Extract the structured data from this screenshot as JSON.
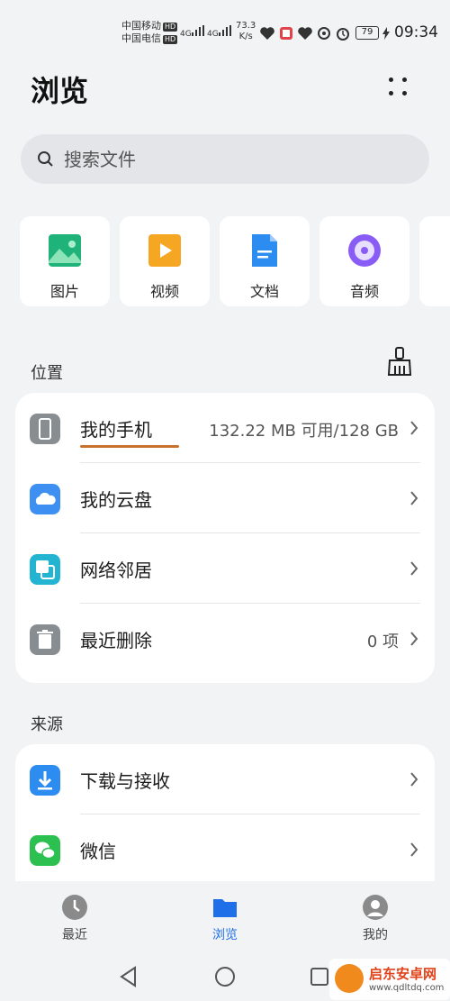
{
  "status_bar": {
    "carrier1": "中国移动",
    "carrier2": "中国电信",
    "hd": "HD",
    "net1": "4G",
    "net2": "4G",
    "speed_value": "73.3",
    "speed_unit": "K/s",
    "battery": "79",
    "time": "09:34"
  },
  "header": {
    "title": "浏览"
  },
  "search": {
    "placeholder": "搜索文件"
  },
  "categories": [
    {
      "label": "图片",
      "icon": "image-icon",
      "color": "#1fb37a"
    },
    {
      "label": "视频",
      "icon": "video-icon",
      "color": "#f5a623"
    },
    {
      "label": "文档",
      "icon": "document-icon",
      "color": "#2d8cf0"
    },
    {
      "label": "音频",
      "icon": "audio-icon",
      "color": "#8a5cf6"
    }
  ],
  "locations": {
    "title": "位置",
    "items": [
      {
        "label": "我的手机",
        "value": "132.22 MB 可用/128 GB",
        "icon": "phone-icon"
      },
      {
        "label": "我的云盘",
        "value": "",
        "icon": "cloud-icon"
      },
      {
        "label": "网络邻居",
        "value": "",
        "icon": "network-icon"
      },
      {
        "label": "最近删除",
        "value": "0 项",
        "icon": "trash-icon"
      }
    ]
  },
  "sources": {
    "title": "来源",
    "items": [
      {
        "label": "下载与接收",
        "icon": "download-icon"
      },
      {
        "label": "微信",
        "icon": "wechat-icon"
      }
    ]
  },
  "bottom_nav": [
    {
      "label": "最近",
      "icon": "clock-icon",
      "active": false
    },
    {
      "label": "浏览",
      "icon": "folder-icon",
      "active": true
    },
    {
      "label": "我的",
      "icon": "profile-icon",
      "active": false
    }
  ],
  "watermark": {
    "name": "启东安卓网",
    "url": "www.qdltdq.com"
  },
  "colors": {
    "accent": "#1f6fe8",
    "underline": "#c9712a",
    "background": "#f1f3f5"
  }
}
